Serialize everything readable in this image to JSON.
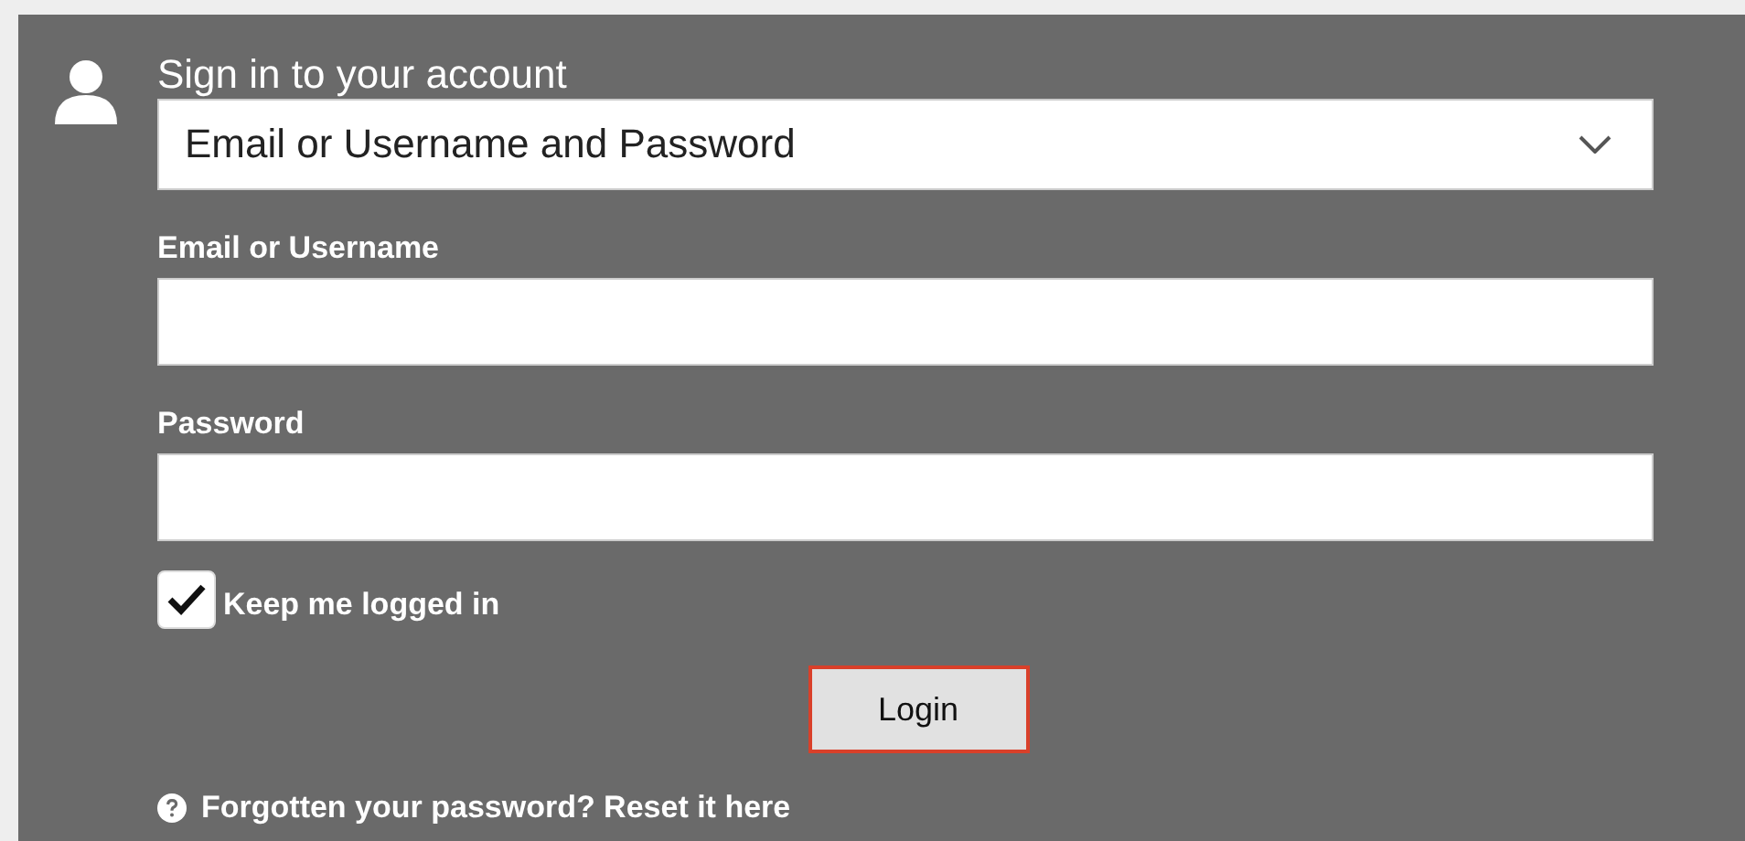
{
  "title": "Sign in to your account",
  "method_select": {
    "value": "Email or Username and Password"
  },
  "fields": [
    {
      "label": "Email or Username"
    },
    {
      "label": "Password"
    }
  ],
  "keep_logged_in": {
    "label": "Keep me logged in",
    "checked": true
  },
  "login_button": "Login",
  "forgot_link": "Forgotten your password? Reset it here"
}
